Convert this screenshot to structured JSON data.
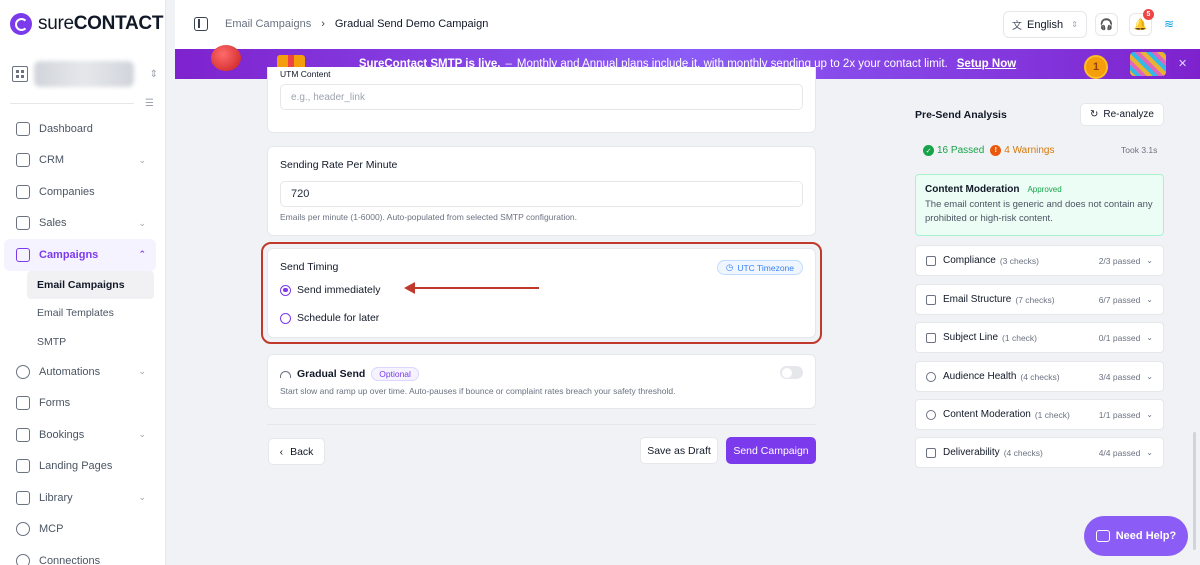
{
  "app": {
    "brand_bold": "sure",
    "brand_rest": "CONTACT"
  },
  "sidebar": {
    "nav": [
      {
        "label": "Dashboard"
      },
      {
        "label": "CRM"
      },
      {
        "label": "Companies"
      },
      {
        "label": "Sales"
      },
      {
        "label": "Campaigns"
      },
      {
        "label": "Automations"
      },
      {
        "label": "Forms"
      },
      {
        "label": "Bookings"
      },
      {
        "label": "Landing Pages"
      },
      {
        "label": "Library"
      },
      {
        "label": "MCP"
      },
      {
        "label": "Connections"
      }
    ],
    "campaign_sub": [
      {
        "label": "Email Campaigns"
      },
      {
        "label": "Email Templates"
      },
      {
        "label": "SMTP"
      }
    ]
  },
  "topbar": {
    "breadcrumb": [
      "Email Campaigns",
      "Gradual Send Demo Campaign"
    ],
    "language": "English",
    "notification_count": "5"
  },
  "banner": {
    "headline": "SureContact SMTP is live.",
    "text": "Monthly and Annual plans include it, with monthly sending up to 2x your contact limit.",
    "cta": "Setup Now"
  },
  "form": {
    "utm_content": {
      "label": "UTM Content",
      "placeholder": "e.g., header_link"
    },
    "sending_rate": {
      "label": "Sending Rate Per Minute",
      "value": "720",
      "help": "Emails per minute (1-6000). Auto-populated from selected SMTP configuration."
    },
    "send_timing": {
      "label": "Send Timing",
      "timezone": "UTC Timezone",
      "options": [
        {
          "label": "Send immediately",
          "selected": true
        },
        {
          "label": "Schedule for later",
          "selected": false
        }
      ]
    },
    "gradual_send": {
      "label": "Gradual Send",
      "badge": "Optional",
      "help": "Start slow and ramp up over time. Auto-pauses if bounce or complaint rates breach your safety threshold.",
      "enabled": false
    }
  },
  "actions": {
    "back": "Back",
    "draft": "Save as Draft",
    "send": "Send Campaign"
  },
  "analysis": {
    "title": "Pre-Send Analysis",
    "reanalyze": "Re-analyze",
    "passed": "16 Passed",
    "warnings": "4 Warnings",
    "took": "Took 3.1s",
    "moderation": {
      "title": "Content Moderation",
      "status": "Approved",
      "text": "The email content is generic and does not contain any prohibited or high-risk content."
    },
    "checks": [
      {
        "name": "Compliance",
        "count": "(3 checks)",
        "result": "2/3 passed"
      },
      {
        "name": "Email Structure",
        "count": "(7 checks)",
        "result": "6/7 passed"
      },
      {
        "name": "Subject Line",
        "count": "(1 check)",
        "result": "0/1 passed"
      },
      {
        "name": "Audience Health",
        "count": "(4 checks)",
        "result": "3/4 passed"
      },
      {
        "name": "Content Moderation",
        "count": "(1 check)",
        "result": "1/1 passed"
      },
      {
        "name": "Deliverability",
        "count": "(4 checks)",
        "result": "4/4 passed"
      }
    ]
  },
  "help_button": "Need Help?",
  "colors": {
    "accent": "#7c3aed",
    "annotation": "#c0392b",
    "success": "#16a34a",
    "warning": "#ea580c"
  }
}
